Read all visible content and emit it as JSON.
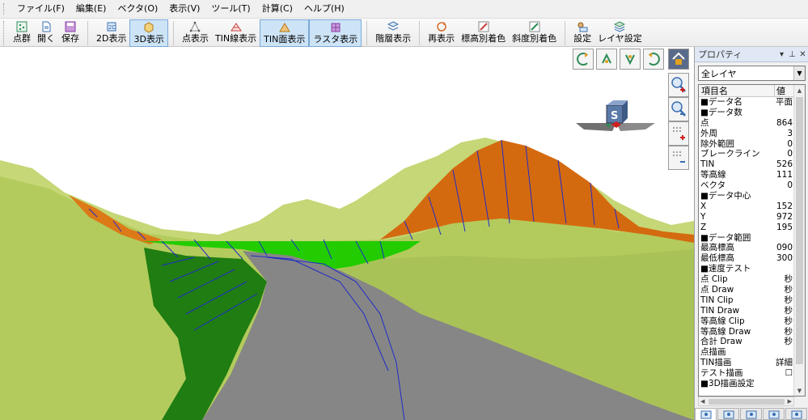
{
  "menu": [
    "ファイル(F)",
    "編集(E)",
    "ベクタ(O)",
    "表示(V)",
    "ツール(T)",
    "計算(C)",
    "ヘルプ(H)"
  ],
  "toolbar": [
    {
      "label": "点群",
      "icon": "point-cloud-icon",
      "color": "#2e8b57"
    },
    {
      "label": "開く",
      "icon": "open-icon",
      "color": "#3a6fb0"
    },
    {
      "label": "保存",
      "icon": "save-icon",
      "color": "#8a3fa8"
    },
    {
      "label": "2D表示",
      "icon": "view-2d-icon",
      "color": "#3a6fb0"
    },
    {
      "label": "3D表示",
      "icon": "view-3d-icon",
      "color": "#d49a28",
      "active": true
    },
    {
      "label": "点表示",
      "icon": "point-display-icon",
      "color": "#888888"
    },
    {
      "label": "TIN線表示",
      "icon": "tin-line-icon",
      "color": "#c84040"
    },
    {
      "label": "TIN面表示",
      "icon": "tin-face-icon",
      "color": "#d49a28",
      "active": true
    },
    {
      "label": "ラスタ表示",
      "icon": "raster-icon",
      "color": "#8a3fa8",
      "active": true
    },
    {
      "label": "階層表示",
      "icon": "layer-display-icon",
      "color": "#3a6fb0"
    },
    {
      "label": "再表示",
      "icon": "redraw-icon",
      "color": "#d46a28"
    },
    {
      "label": "標高別着色",
      "icon": "elevation-color-icon",
      "color": "#c84040"
    },
    {
      "label": "斜度別着色",
      "icon": "slope-color-icon",
      "color": "#2e8b57"
    },
    {
      "label": "設定",
      "icon": "settings-icon",
      "color": "#3a6fb0"
    },
    {
      "label": "レイヤ設定",
      "icon": "layer-settings-icon",
      "color": "#3a6fb0"
    }
  ],
  "panel": {
    "title": "プロパティ",
    "layer_select": "全レイヤ",
    "col_name": "項目名",
    "col_value": "値",
    "rows": [
      {
        "name": "■データ名",
        "value": "平面"
      },
      {
        "name": "■データ数",
        "value": ""
      },
      {
        "name": "点",
        "value": "864"
      },
      {
        "name": "外周",
        "value": "3"
      },
      {
        "name": "除外範囲",
        "value": "0"
      },
      {
        "name": "ブレークライン",
        "value": "0"
      },
      {
        "name": "TIN",
        "value": "526"
      },
      {
        "name": "等高線",
        "value": "111"
      },
      {
        "name": "ベクタ",
        "value": "0"
      },
      {
        "name": "■データ中心",
        "value": ""
      },
      {
        "name": "X",
        "value": "152"
      },
      {
        "name": "Y",
        "value": "972"
      },
      {
        "name": "Z",
        "value": "195"
      },
      {
        "name": "■データ範囲",
        "value": ""
      },
      {
        "name": "最高標高",
        "value": "090"
      },
      {
        "name": "最低標高",
        "value": "300"
      },
      {
        "name": "■速度テスト",
        "value": ""
      },
      {
        "name": "点 Clip",
        "value": "秒"
      },
      {
        "name": "点 Draw",
        "value": "秒"
      },
      {
        "name": "TIN Clip",
        "value": "秒"
      },
      {
        "name": "TIN Draw",
        "value": "秒"
      },
      {
        "name": "等高線 Clip",
        "value": "秒"
      },
      {
        "name": "等高線 Draw",
        "value": "秒"
      },
      {
        "name": "合計 Draw",
        "value": "秒"
      },
      {
        "name": "点描画",
        "value": ""
      },
      {
        "name": "TIN描画",
        "value": "詳細"
      },
      {
        "name": "テスト描画",
        "value": "☐"
      },
      {
        "name": "■3D描画設定",
        "value": ""
      }
    ]
  },
  "colors": {
    "terrain": "#b9cf63",
    "cut_face": "#d86a12",
    "green_fill": "#22cc00",
    "dark_green": "#1f7d12",
    "road": "#868686",
    "blue_lines": "#1f2bc8"
  }
}
